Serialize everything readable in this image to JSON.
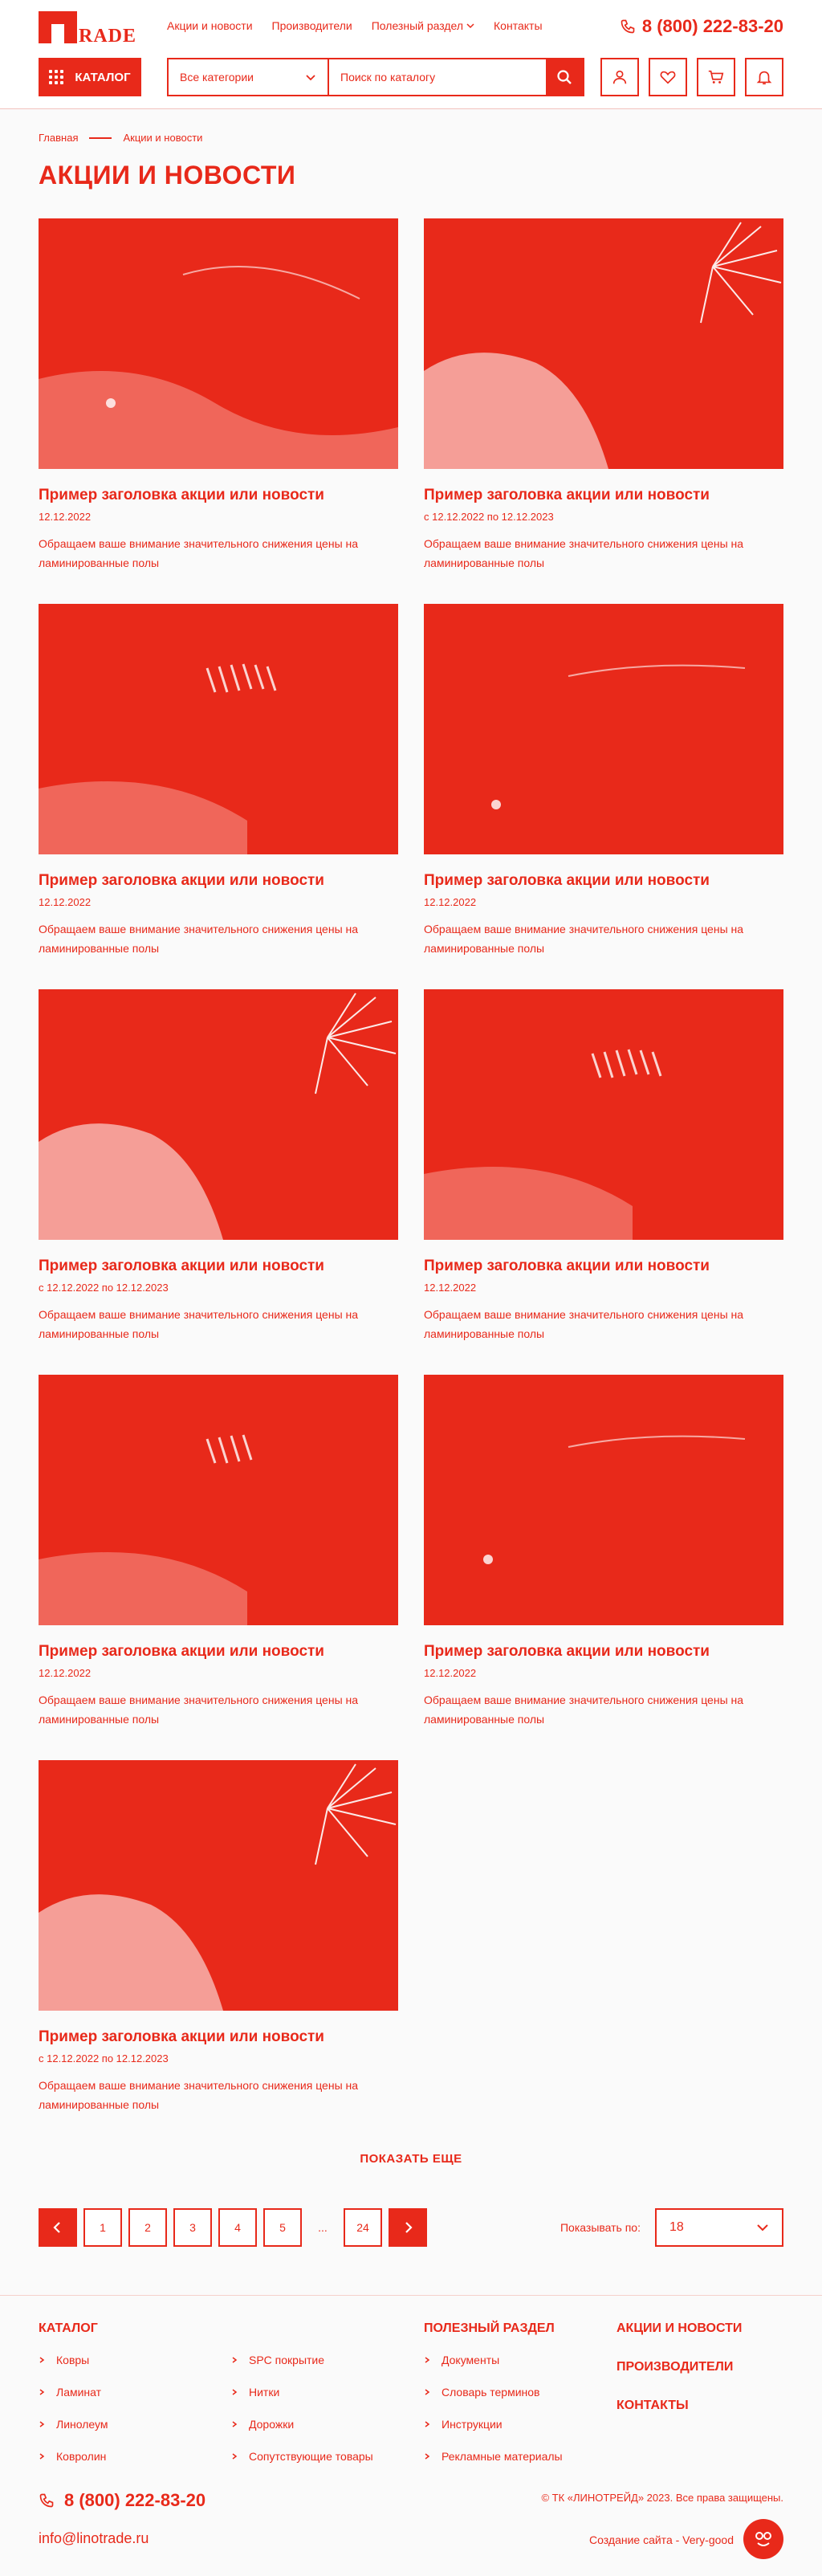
{
  "header": {
    "logo_text": "RADE",
    "nav": [
      "Акции и новости",
      "Производители",
      "Полезный раздел",
      "Контакты"
    ],
    "phone": "8 (800) 222-83-20",
    "catalog_label": "КАТАЛОГ",
    "category_select": "Все категории",
    "search_placeholder": "Поиск по каталогу",
    "icons": [
      "user-icon",
      "heart-icon",
      "cart-icon",
      "bell-icon"
    ]
  },
  "breadcrumb": [
    "Главная",
    "Акции и новости"
  ],
  "page_title": "АКЦИИ И НОВОСТИ",
  "cards": [
    {
      "title": "Пример заголовка акции или новости",
      "date": "12.12.2022",
      "desc": "Обращаем ваше внимание значительного снижения цены на ламинированные полы"
    },
    {
      "title": "Пример заголовка акции или новости",
      "date": "с 12.12.2022 по 12.12.2023",
      "desc": "Обращаем ваше внимание значительного снижения цены на ламинированные полы"
    },
    {
      "title": "Пример заголовка акции или новости",
      "date": "12.12.2022",
      "desc": "Обращаем ваше внимание значительного снижения цены на ламинированные полы"
    },
    {
      "title": "Пример заголовка акции или новости",
      "date": "12.12.2022",
      "desc": "Обращаем ваше внимание значительного снижения цены на ламинированные полы"
    },
    {
      "title": "Пример заголовка акции или новости",
      "date": "с 12.12.2022 по 12.12.2023",
      "desc": "Обращаем ваше внимание значительного снижения цены на ламинированные полы"
    },
    {
      "title": "Пример заголовка акции или новости",
      "date": "12.12.2022",
      "desc": "Обращаем ваше внимание значительного снижения цены на ламинированные полы"
    },
    {
      "title": "Пример заголовка акции или новости",
      "date": "12.12.2022",
      "desc": "Обращаем ваше внимание значительного снижения цены на ламинированные полы"
    },
    {
      "title": "Пример заголовка акции или новости",
      "date": "12.12.2022",
      "desc": "Обращаем ваше внимание значительного снижения цены на ламинированные полы"
    },
    {
      "title": "Пример заголовка акции или новости",
      "date": "с 12.12.2022 по 12.12.2023",
      "desc": "Обращаем ваше внимание значительного снижения цены на ламинированные полы"
    }
  ],
  "show_more": "ПОКАЗАТЬ ЕЩЕ",
  "pagination": {
    "pages": [
      "1",
      "2",
      "3",
      "4",
      "5"
    ],
    "ellipsis": "...",
    "last": "24"
  },
  "per_page": {
    "label": "Показывать по:",
    "value": "18"
  },
  "footer": {
    "catalog_title": "КАТАЛОГ",
    "catalog_col1": [
      "Ковры",
      "Ламинат",
      "Линолеум",
      "Ковролин"
    ],
    "catalog_col2": [
      "SPC покрытие",
      "Нитки",
      "Дорожки",
      "Сопутствующие товары"
    ],
    "useful_title": "ПОЛЕЗНЫЙ РАЗДЕЛ",
    "useful_items": [
      "Документы",
      "Словарь терминов",
      "Инструкции",
      "Рекламные материалы"
    ],
    "links": [
      "АКЦИИ И НОВОСТИ",
      "ПРОИЗВОДИТЕЛИ",
      "КОНТАКТЫ"
    ],
    "phone": "8 (800) 222-83-20",
    "email": "info@linotrade.ru",
    "copyright": "© ТК «ЛИНОТРЕЙД» 2023. Все права защищены.",
    "developer": "Создание сайта - Very-good"
  },
  "colors": {
    "accent": "#e8291a",
    "background": "#fafafa"
  }
}
